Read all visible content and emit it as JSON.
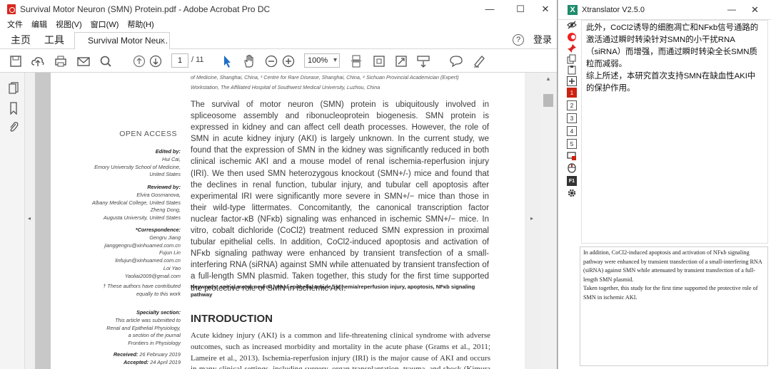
{
  "acrobat": {
    "window_title": "Survival Motor Neuron (SMN) Protein.pdf - Adobe Acrobat Pro DC",
    "window_controls": [
      "—",
      "☐",
      "✕"
    ],
    "menu": [
      "文件",
      "编辑",
      "视图(V)",
      "窗口(W)",
      "帮助(H)"
    ],
    "nav_tabs": {
      "home": "主页",
      "tools": "工具"
    },
    "doc_tab": {
      "label": "Survival Motor Neu...",
      "close": "×"
    },
    "help": "?",
    "signin": "登录",
    "page_current": "1",
    "page_total": "/ 11",
    "zoom": "100%"
  },
  "pdf": {
    "affiliation_line1": "of Medicine, Shanghai, China, ³ Centre for Rare Disease, Shanghai, China, ⁴ Sichuan Provincial Academician (Expert)",
    "affiliation_line2": "Workstation, The Affiliated Hospital of Southwest Medical University, Luzhou, China",
    "abstract": "The survival of motor neuron (SMN) protein is ubiquitously involved in spliceosome assembly and ribonucleoprotein biogenesis. SMN protein is expressed in kidney and can affect cell death processes. However, the role of SMN in acute kidney injury (AKI) is largely unknown. In the current study, we found that the expression of SMN in the kidney was significantly reduced in both clinical ischemic AKI and a mouse model of renal ischemia-reperfusion injury (IRI). We then used SMN heterozygous knockout (SMN+/-) mice and found that the declines in renal function, tubular injury, and tubular cell apoptosis after experimental IRI were significantly more severe in SMN+/− mice than those in their wild-type littermates. Concomitantly, the canonical transcription factor nuclear factor-κB (NFκb) signaling was enhanced in ischemic SMN+/− mice. In vitro, cobalt dichloride (CoCl2) treatment reduced SMN expression in proximal tubular epithelial cells. In addition, CoCl2-induced apoptosis and activation of NFκb signaling pathway were enhanced by transient transfection of a small-interfering RNA (siRNA) against SMN while attenuated by transient transfection of a full-length SMN plasmid. Taken together, this study for the first time supported the protective role of SMN in ischemic AKI.",
    "keywords_label": "Keywords:",
    "keywords": "spinal motor neuron, renal epithelial tubule, ischemia/reperfusion injury, apoptosis, NFκb signaling pathway",
    "intro_heading": "INTRODUCTION",
    "intro_text": "Acute kidney injury (AKI) is a common and life-threatening clinical syndrome with adverse outcomes, such as increased morbidity and mortality in the acute phase (Grams et al., 2011; Lameire et al., 2013). Ischemia-reperfusion injury (IRI) is the major cause of AKI and occurs in many clinical settings, including surgery, organ transplantation, trauma, and shock (Kimura et al.,",
    "open_access": "OPEN ACCESS",
    "edited_by_label": "Edited by:",
    "edited_by": [
      "Hui Cai,",
      "Emory University School of Medicine,",
      "United States"
    ],
    "reviewed_by_label": "Reviewed by:",
    "reviewed_by": [
      "Elvira Gosmanova,",
      "Albany Medical College, United States",
      "Zheng Dong,",
      "Augusta University, United States"
    ],
    "correspondence_label": "*Correspondence:",
    "correspondence": [
      "Gengru Jiang",
      "jianggengru@xinhuamed.com.cn",
      "Fujun Lin",
      "linfujun@xinhuamed.com.cn",
      "Loi Yao",
      "Yaoliai2009@gmail.com"
    ],
    "authors_note": [
      "† These authors have contributed",
      "equally to this work"
    ],
    "specialty_label": "Specialty section:",
    "specialty": [
      "This article was submitted to",
      "Renal and Epithelial Physiology,",
      "a section of the journal",
      "Frontiers in Physiology"
    ],
    "received_label": "Received:",
    "received": "26 February 2019",
    "accepted_label": "Accepted:",
    "accepted": "24 April 2019"
  },
  "xtranslator": {
    "title": "Xtranslator V2.5.0",
    "minimize": "—",
    "close": "✕",
    "tool_numbers": [
      "1",
      "2",
      "3",
      "4",
      "5"
    ],
    "translation": [
      "此外，CoCl2诱导的细胞凋亡和NFκb信号通路的激活通过瞬时转染针对SMN的小干扰RNA（siRNA）而增强，而通过瞬时转染全长SMN质粒而减弱。",
      "综上所述，本研究首次支持SMN在缺血性AKI中的保护作用。"
    ],
    "source_text": [
      "In addition, CoCl2-induced apoptosis and activation of NFκb signaling pathway were enhanced by transient transfection of a small-interfering RNA (siRNA) against SMN while attenuated by transient transfection of a full-length SMN plasmid.",
      "Taken together, this study for the first time supported the protective role of SMN in ischemic AKI."
    ]
  }
}
